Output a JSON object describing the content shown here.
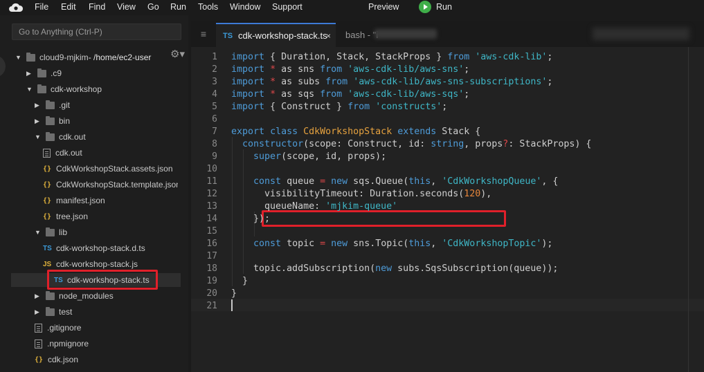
{
  "menubar": {
    "items": [
      "File",
      "Edit",
      "Find",
      "View",
      "Go",
      "Run",
      "Tools",
      "Window",
      "Support"
    ],
    "preview": "Preview",
    "run": "Run"
  },
  "sidebar": {
    "goto_placeholder": "Go to Anything (Ctrl-P)",
    "tree": [
      {
        "label": "cloud9-mjkim",
        "suffix": " - /home/ec2-user",
        "type": "folder",
        "depth": 0,
        "expanded": true
      },
      {
        "label": ".c9",
        "type": "folder",
        "depth": 1,
        "expanded": false
      },
      {
        "label": "cdk-workshop",
        "type": "folder",
        "depth": 1,
        "expanded": true
      },
      {
        "label": ".git",
        "type": "folder",
        "depth": 2,
        "expanded": false
      },
      {
        "label": "bin",
        "type": "folder",
        "depth": 2,
        "expanded": false
      },
      {
        "label": "cdk.out",
        "type": "folder",
        "depth": 2,
        "expanded": true
      },
      {
        "label": "cdk.out",
        "type": "file",
        "depth": 3
      },
      {
        "label": "CdkWorkshopStack.assets.json",
        "type": "json",
        "depth": 3
      },
      {
        "label": "CdkWorkshopStack.template.json",
        "type": "json",
        "depth": 3
      },
      {
        "label": "manifest.json",
        "type": "json",
        "depth": 3
      },
      {
        "label": "tree.json",
        "type": "json",
        "depth": 3
      },
      {
        "label": "lib",
        "type": "folder",
        "depth": 2,
        "expanded": true
      },
      {
        "label": "cdk-workshop-stack.d.ts",
        "type": "ts",
        "depth": 3
      },
      {
        "label": "cdk-workshop-stack.js",
        "type": "js",
        "depth": 3
      },
      {
        "label": "cdk-workshop-stack.ts",
        "type": "ts",
        "depth": 3,
        "selected": true
      },
      {
        "label": "node_modules",
        "type": "folder",
        "depth": 2,
        "expanded": false
      },
      {
        "label": "test",
        "type": "folder",
        "depth": 2,
        "expanded": false
      },
      {
        "label": ".gitignore",
        "type": "file",
        "depth": 2
      },
      {
        "label": ".npmignore",
        "type": "file",
        "depth": 2
      },
      {
        "label": "cdk.json",
        "type": "json",
        "depth": 2
      }
    ]
  },
  "editor": {
    "tabs": [
      {
        "icon": "TS",
        "label": "cdk-workshop-stack.ts",
        "close": "×",
        "active": true
      },
      {
        "label": "bash - \"i",
        "active": false
      }
    ],
    "line_numbers": [
      "1",
      "2",
      "3",
      "4",
      "5",
      "6",
      "7",
      "8",
      "9",
      "10",
      "11",
      "12",
      "13",
      "14",
      "15",
      "16",
      "17",
      "18",
      "19",
      "20",
      "21"
    ],
    "code": [
      [
        [
          "kw",
          "import"
        ],
        [
          "pl",
          " { Duration, Stack, StackProps } "
        ],
        [
          "kw",
          "from"
        ],
        [
          "pl",
          " "
        ],
        [
          "str",
          "'aws-cdk-lib'"
        ],
        [
          "pl",
          ";"
        ]
      ],
      [
        [
          "kw",
          "import"
        ],
        [
          "pl",
          " "
        ],
        [
          "op",
          "*"
        ],
        [
          "pl",
          " as sns "
        ],
        [
          "kw",
          "from"
        ],
        [
          "pl",
          " "
        ],
        [
          "str",
          "'aws-cdk-lib/aws-sns'"
        ],
        [
          "pl",
          ";"
        ]
      ],
      [
        [
          "kw",
          "import"
        ],
        [
          "pl",
          " "
        ],
        [
          "op",
          "*"
        ],
        [
          "pl",
          " as subs "
        ],
        [
          "kw",
          "from"
        ],
        [
          "pl",
          " "
        ],
        [
          "str",
          "'aws-cdk-lib/aws-sns-subscriptions'"
        ],
        [
          "pl",
          ";"
        ]
      ],
      [
        [
          "kw",
          "import"
        ],
        [
          "pl",
          " "
        ],
        [
          "op",
          "*"
        ],
        [
          "pl",
          " as sqs "
        ],
        [
          "kw",
          "from"
        ],
        [
          "pl",
          " "
        ],
        [
          "str",
          "'aws-cdk-lib/aws-sqs'"
        ],
        [
          "pl",
          ";"
        ]
      ],
      [
        [
          "kw",
          "import"
        ],
        [
          "pl",
          " { Construct } "
        ],
        [
          "kw",
          "from"
        ],
        [
          "pl",
          " "
        ],
        [
          "str",
          "'constructs'"
        ],
        [
          "pl",
          ";"
        ]
      ],
      [],
      [
        [
          "kw",
          "export"
        ],
        [
          "pl",
          " "
        ],
        [
          "kw",
          "class"
        ],
        [
          "pl",
          " "
        ],
        [
          "cls",
          "CdkWorkshopStack"
        ],
        [
          "pl",
          " "
        ],
        [
          "kw",
          "extends"
        ],
        [
          "pl",
          " Stack {"
        ]
      ],
      [
        [
          "pl",
          "  "
        ],
        [
          "kw",
          "constructor"
        ],
        [
          "pl",
          "(scope: Construct, id: "
        ],
        [
          "kw",
          "string"
        ],
        [
          "pl",
          ", props"
        ],
        [
          "op",
          "?"
        ],
        [
          "pl",
          ": StackProps) {"
        ]
      ],
      [
        [
          "pl",
          "    "
        ],
        [
          "kw",
          "super"
        ],
        [
          "pl",
          "(scope, id, props);"
        ]
      ],
      [],
      [
        [
          "pl",
          "    "
        ],
        [
          "kw",
          "const"
        ],
        [
          "pl",
          " queue "
        ],
        [
          "op",
          "="
        ],
        [
          "pl",
          " "
        ],
        [
          "kw",
          "new"
        ],
        [
          "pl",
          " sqs.Queue("
        ],
        [
          "kw",
          "this"
        ],
        [
          "pl",
          ", "
        ],
        [
          "str",
          "'CdkWorkshopQueue'"
        ],
        [
          "pl",
          ", {"
        ]
      ],
      [
        [
          "pl",
          "      visibilityTimeout: Duration.seconds("
        ],
        [
          "num",
          "120"
        ],
        [
          "pl",
          "),"
        ]
      ],
      [
        [
          "pl",
          "      queueName: "
        ],
        [
          "str",
          "'mjkim-queue'"
        ]
      ],
      [
        [
          "pl",
          "    });"
        ]
      ],
      [],
      [
        [
          "pl",
          "    "
        ],
        [
          "kw",
          "const"
        ],
        [
          "pl",
          " topic "
        ],
        [
          "op",
          "="
        ],
        [
          "pl",
          " "
        ],
        [
          "kw",
          "new"
        ],
        [
          "pl",
          " sns.Topic("
        ],
        [
          "kw",
          "this"
        ],
        [
          "pl",
          ", "
        ],
        [
          "str",
          "'CdkWorkshopTopic'"
        ],
        [
          "pl",
          ");"
        ]
      ],
      [],
      [
        [
          "pl",
          "    topic.addSubscription("
        ],
        [
          "kw",
          "new"
        ],
        [
          "pl",
          " subs.SqsSubscription(queue));"
        ]
      ],
      [
        [
          "pl",
          "  }"
        ]
      ],
      [
        [
          "pl",
          "}"
        ]
      ],
      []
    ]
  },
  "colors": {
    "highlight_box": "#e0202a",
    "keyword": "#4e9cd9",
    "string": "#3fb7c7",
    "number": "#e8863b",
    "class_name": "#e6a23f",
    "run_green": "#3fae49"
  }
}
